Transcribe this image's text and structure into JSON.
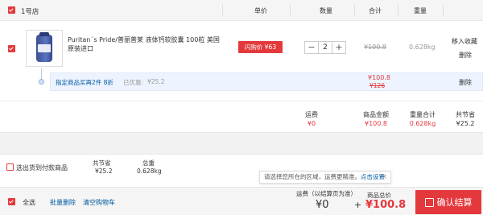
{
  "header": {
    "store_name": "1号店",
    "col_price": "单价",
    "col_qty": "数量",
    "col_total": "合计",
    "col_weight": "重量"
  },
  "product": {
    "title": "Puritan´s Pride/普丽普莱 液体钙软胶囊 100粒 美国原装进口",
    "promo_label": "闪购价 ¥63",
    "quantity": "2",
    "minus": "−",
    "plus": "+",
    "original_total": "¥100.8",
    "weight": "0.628kg",
    "action_favorite": "移入收藏",
    "action_delete": "删除"
  },
  "promo_strip": {
    "text": "指定商品买再2件 8折",
    "saved_label": "已优惠:",
    "saved_value": "¥25.2",
    "price_now": "¥100.8",
    "price_before": "¥126",
    "delete": "删除"
  },
  "subtotal": {
    "shipping_label": "运费",
    "shipping_value": "¥0",
    "amount_label": "商品金额",
    "amount_value": "¥100.8",
    "weight_label": "重量合计",
    "weight_value": "0.628kg",
    "saved_label": "共节省",
    "saved_value": "¥25.2"
  },
  "summary": {
    "select_cod": "选出货到付款商品",
    "saved_label": "共节省",
    "saved_value": "¥25.2",
    "weight_label": "总重",
    "weight_value": "0.628kg"
  },
  "tip": {
    "text": "请选择您所在的区域，运费更精准。",
    "link": "点击设置",
    "close": "×"
  },
  "footer": {
    "select_all": "全选",
    "batch_delete": "批量删除",
    "clear_cart": "清空购物车",
    "shipping_label": "运费（以结算页为准）",
    "shipping_value": "¥0",
    "plus_sign": "+",
    "total_label": "商品总价",
    "total_value": "¥100.8",
    "checkout": "确认结算"
  },
  "colors": {
    "brand_red": "#e4393c",
    "link_blue": "#005aa0"
  }
}
